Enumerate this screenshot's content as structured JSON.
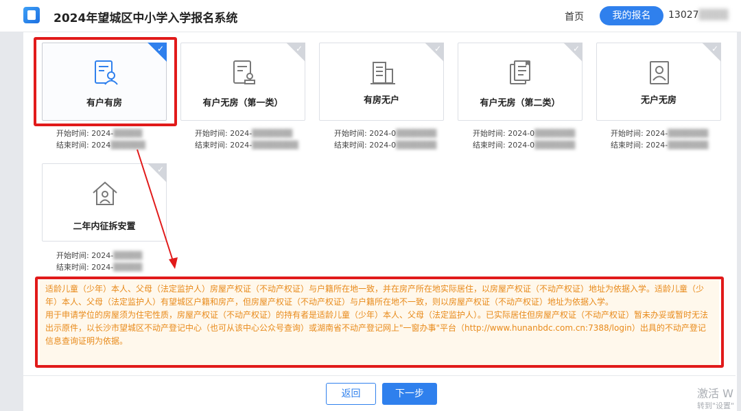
{
  "header": {
    "app_title": "2024年望城区中小学入学报名系统",
    "nav_home": "首页",
    "nav_my_registration": "我的报名",
    "user_phone_visible": "13027",
    "user_phone_blurred": "▒▒▒▒",
    "accent_color": "#2f80ed"
  },
  "categories": [
    {
      "label": "有户有房",
      "icon": "person-document-icon",
      "selected": true,
      "start_label": "开始时间: 2024-",
      "start_value": "▒▒▒▒▒",
      "end_label": "结束时间: 2024",
      "end_value": "▒▒▒▒▒▒"
    },
    {
      "label": "有户无房（第一类）",
      "icon": "stamp-document-icon",
      "selected": false,
      "start_label": "开始时间: 2024-",
      "start_value": "▒▒▒▒▒▒▒",
      "end_label": "结束时间: 2024-",
      "end_value": "▒▒▒▒▒▒▒▒"
    },
    {
      "label": "有房无户",
      "icon": "building-icon",
      "selected": false,
      "start_label": "开始时间: 2024-0",
      "start_value": "▒▒▒▒▒▒▒",
      "end_label": "结束时间: 2024-0",
      "end_value": "▒▒▒▒▒▒▒"
    },
    {
      "label": "有户无房（第二类）",
      "icon": "document-stack-icon",
      "selected": false,
      "start_label": "开始时间: 2024-0",
      "start_value": "▒▒▒▒▒▒▒",
      "end_label": "结束时间: 2024-0",
      "end_value": "▒▒▒▒▒▒▒"
    },
    {
      "label": "无户无房",
      "icon": "person-frame-icon",
      "selected": false,
      "start_label": "开始时间: 2024-",
      "start_value": "▒▒▒▒▒▒▒",
      "end_label": "结束时间: 2024-",
      "end_value": "▒▒▒▒▒▒▒"
    },
    {
      "label": "二年内征拆安置",
      "icon": "house-person-icon",
      "selected": false,
      "start_label": "开始时间: 2024-",
      "start_value": "▒▒▒▒▒",
      "end_label": "结束时间: 2024-",
      "end_value": "▒▒▒▒▒"
    }
  ],
  "notice": {
    "paragraph1": "适龄儿童（少年）本人、父母（法定监护人）房屋产权证（不动产权证）与户籍所在地一致，并在房产所在地实际居住，以房屋产权证（不动产权证）地址为依据入学。适龄儿童（少年）本人、父母（法定监护人）有望城区户籍和房产，但房屋产权证（不动产权证）与户籍所在地不一致，则以房屋产权证（不动产权证）地址为依据入学。",
    "paragraph2": "用于申请学位的房屋须为住宅性质，房屋产权证（不动产权证）的持有者是适龄儿童（少年）本人、父母（法定监护人）。已实际居住但房屋产权证（不动产权证）暂未办妥或暂时无法出示原件，以长沙市望城区不动产登记中心（也可从该中心公众号查询）或湖南省不动产登记网上\"一窗办事\"平台（http://www.hunanbdc.com.cn:7388/login）出具的不动产登记信息查询证明为依据。",
    "text_color": "#e88a1a"
  },
  "footer": {
    "back_label": "返回",
    "next_label": "下一步"
  },
  "watermark": {
    "line1": "激活 W",
    "line2": "转到\"设置\""
  },
  "highlight_color": "#e11a1a"
}
